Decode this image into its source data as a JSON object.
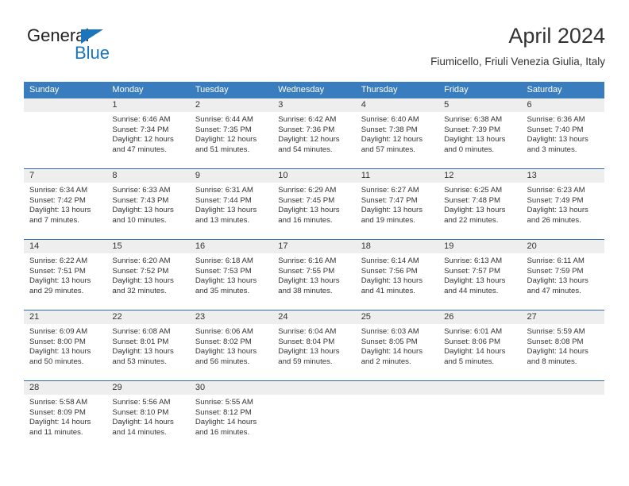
{
  "brand": {
    "name_top": "General",
    "name_bottom": "Blue",
    "accent_color": "#1b75bb"
  },
  "header": {
    "title": "April 2024",
    "location": "Fiumicello, Friuli Venezia Giulia, Italy"
  },
  "calendar": {
    "header_color": "#3a7dbf",
    "week_rule_color": "#2f6ca8",
    "daynum_band_color": "#eeeeee",
    "weekdays": [
      "Sunday",
      "Monday",
      "Tuesday",
      "Wednesday",
      "Thursday",
      "Friday",
      "Saturday"
    ],
    "labels": {
      "sunrise": "Sunrise:",
      "sunset": "Sunset:",
      "daylight": "Daylight:"
    },
    "weeks": [
      [
        {
          "day": "",
          "sunrise": "",
          "sunset": "",
          "daylight_1": "",
          "daylight_2": ""
        },
        {
          "day": "1",
          "sunrise": "Sunrise: 6:46 AM",
          "sunset": "Sunset: 7:34 PM",
          "daylight_1": "Daylight: 12 hours",
          "daylight_2": "and 47 minutes."
        },
        {
          "day": "2",
          "sunrise": "Sunrise: 6:44 AM",
          "sunset": "Sunset: 7:35 PM",
          "daylight_1": "Daylight: 12 hours",
          "daylight_2": "and 51 minutes."
        },
        {
          "day": "3",
          "sunrise": "Sunrise: 6:42 AM",
          "sunset": "Sunset: 7:36 PM",
          "daylight_1": "Daylight: 12 hours",
          "daylight_2": "and 54 minutes."
        },
        {
          "day": "4",
          "sunrise": "Sunrise: 6:40 AM",
          "sunset": "Sunset: 7:38 PM",
          "daylight_1": "Daylight: 12 hours",
          "daylight_2": "and 57 minutes."
        },
        {
          "day": "5",
          "sunrise": "Sunrise: 6:38 AM",
          "sunset": "Sunset: 7:39 PM",
          "daylight_1": "Daylight: 13 hours",
          "daylight_2": "and 0 minutes."
        },
        {
          "day": "6",
          "sunrise": "Sunrise: 6:36 AM",
          "sunset": "Sunset: 7:40 PM",
          "daylight_1": "Daylight: 13 hours",
          "daylight_2": "and 3 minutes."
        }
      ],
      [
        {
          "day": "7",
          "sunrise": "Sunrise: 6:34 AM",
          "sunset": "Sunset: 7:42 PM",
          "daylight_1": "Daylight: 13 hours",
          "daylight_2": "and 7 minutes."
        },
        {
          "day": "8",
          "sunrise": "Sunrise: 6:33 AM",
          "sunset": "Sunset: 7:43 PM",
          "daylight_1": "Daylight: 13 hours",
          "daylight_2": "and 10 minutes."
        },
        {
          "day": "9",
          "sunrise": "Sunrise: 6:31 AM",
          "sunset": "Sunset: 7:44 PM",
          "daylight_1": "Daylight: 13 hours",
          "daylight_2": "and 13 minutes."
        },
        {
          "day": "10",
          "sunrise": "Sunrise: 6:29 AM",
          "sunset": "Sunset: 7:45 PM",
          "daylight_1": "Daylight: 13 hours",
          "daylight_2": "and 16 minutes."
        },
        {
          "day": "11",
          "sunrise": "Sunrise: 6:27 AM",
          "sunset": "Sunset: 7:47 PM",
          "daylight_1": "Daylight: 13 hours",
          "daylight_2": "and 19 minutes."
        },
        {
          "day": "12",
          "sunrise": "Sunrise: 6:25 AM",
          "sunset": "Sunset: 7:48 PM",
          "daylight_1": "Daylight: 13 hours",
          "daylight_2": "and 22 minutes."
        },
        {
          "day": "13",
          "sunrise": "Sunrise: 6:23 AM",
          "sunset": "Sunset: 7:49 PM",
          "daylight_1": "Daylight: 13 hours",
          "daylight_2": "and 26 minutes."
        }
      ],
      [
        {
          "day": "14",
          "sunrise": "Sunrise: 6:22 AM",
          "sunset": "Sunset: 7:51 PM",
          "daylight_1": "Daylight: 13 hours",
          "daylight_2": "and 29 minutes."
        },
        {
          "day": "15",
          "sunrise": "Sunrise: 6:20 AM",
          "sunset": "Sunset: 7:52 PM",
          "daylight_1": "Daylight: 13 hours",
          "daylight_2": "and 32 minutes."
        },
        {
          "day": "16",
          "sunrise": "Sunrise: 6:18 AM",
          "sunset": "Sunset: 7:53 PM",
          "daylight_1": "Daylight: 13 hours",
          "daylight_2": "and 35 minutes."
        },
        {
          "day": "17",
          "sunrise": "Sunrise: 6:16 AM",
          "sunset": "Sunset: 7:55 PM",
          "daylight_1": "Daylight: 13 hours",
          "daylight_2": "and 38 minutes."
        },
        {
          "day": "18",
          "sunrise": "Sunrise: 6:14 AM",
          "sunset": "Sunset: 7:56 PM",
          "daylight_1": "Daylight: 13 hours",
          "daylight_2": "and 41 minutes."
        },
        {
          "day": "19",
          "sunrise": "Sunrise: 6:13 AM",
          "sunset": "Sunset: 7:57 PM",
          "daylight_1": "Daylight: 13 hours",
          "daylight_2": "and 44 minutes."
        },
        {
          "day": "20",
          "sunrise": "Sunrise: 6:11 AM",
          "sunset": "Sunset: 7:59 PM",
          "daylight_1": "Daylight: 13 hours",
          "daylight_2": "and 47 minutes."
        }
      ],
      [
        {
          "day": "21",
          "sunrise": "Sunrise: 6:09 AM",
          "sunset": "Sunset: 8:00 PM",
          "daylight_1": "Daylight: 13 hours",
          "daylight_2": "and 50 minutes."
        },
        {
          "day": "22",
          "sunrise": "Sunrise: 6:08 AM",
          "sunset": "Sunset: 8:01 PM",
          "daylight_1": "Daylight: 13 hours",
          "daylight_2": "and 53 minutes."
        },
        {
          "day": "23",
          "sunrise": "Sunrise: 6:06 AM",
          "sunset": "Sunset: 8:02 PM",
          "daylight_1": "Daylight: 13 hours",
          "daylight_2": "and 56 minutes."
        },
        {
          "day": "24",
          "sunrise": "Sunrise: 6:04 AM",
          "sunset": "Sunset: 8:04 PM",
          "daylight_1": "Daylight: 13 hours",
          "daylight_2": "and 59 minutes."
        },
        {
          "day": "25",
          "sunrise": "Sunrise: 6:03 AM",
          "sunset": "Sunset: 8:05 PM",
          "daylight_1": "Daylight: 14 hours",
          "daylight_2": "and 2 minutes."
        },
        {
          "day": "26",
          "sunrise": "Sunrise: 6:01 AM",
          "sunset": "Sunset: 8:06 PM",
          "daylight_1": "Daylight: 14 hours",
          "daylight_2": "and 5 minutes."
        },
        {
          "day": "27",
          "sunrise": "Sunrise: 5:59 AM",
          "sunset": "Sunset: 8:08 PM",
          "daylight_1": "Daylight: 14 hours",
          "daylight_2": "and 8 minutes."
        }
      ],
      [
        {
          "day": "28",
          "sunrise": "Sunrise: 5:58 AM",
          "sunset": "Sunset: 8:09 PM",
          "daylight_1": "Daylight: 14 hours",
          "daylight_2": "and 11 minutes."
        },
        {
          "day": "29",
          "sunrise": "Sunrise: 5:56 AM",
          "sunset": "Sunset: 8:10 PM",
          "daylight_1": "Daylight: 14 hours",
          "daylight_2": "and 14 minutes."
        },
        {
          "day": "30",
          "sunrise": "Sunrise: 5:55 AM",
          "sunset": "Sunset: 8:12 PM",
          "daylight_1": "Daylight: 14 hours",
          "daylight_2": "and 16 minutes."
        },
        {
          "day": "",
          "sunrise": "",
          "sunset": "",
          "daylight_1": "",
          "daylight_2": ""
        },
        {
          "day": "",
          "sunrise": "",
          "sunset": "",
          "daylight_1": "",
          "daylight_2": ""
        },
        {
          "day": "",
          "sunrise": "",
          "sunset": "",
          "daylight_1": "",
          "daylight_2": ""
        },
        {
          "day": "",
          "sunrise": "",
          "sunset": "",
          "daylight_1": "",
          "daylight_2": ""
        }
      ]
    ]
  }
}
